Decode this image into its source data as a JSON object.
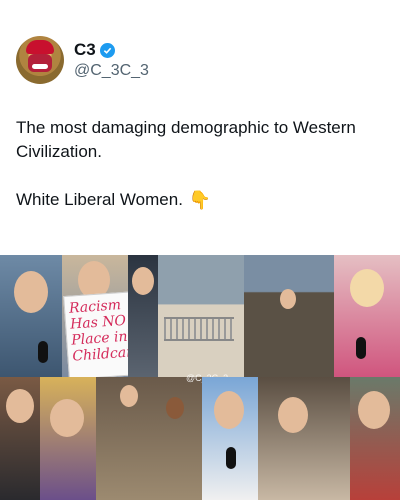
{
  "tweet": {
    "display_name": "C3",
    "handle": "@C_3C_3",
    "verified": true,
    "text_line1": "The most damaging demographic to Western Civilization.",
    "text_line2": "White Liberal Women.",
    "emoji": "👇"
  },
  "image": {
    "sign_text": "Racism Has NO Place in Childcare",
    "watermark": "@C_3C_3"
  },
  "colors": {
    "verified_blue": "#1d9bf0",
    "text_primary": "#0f1419",
    "text_secondary": "#536471"
  }
}
